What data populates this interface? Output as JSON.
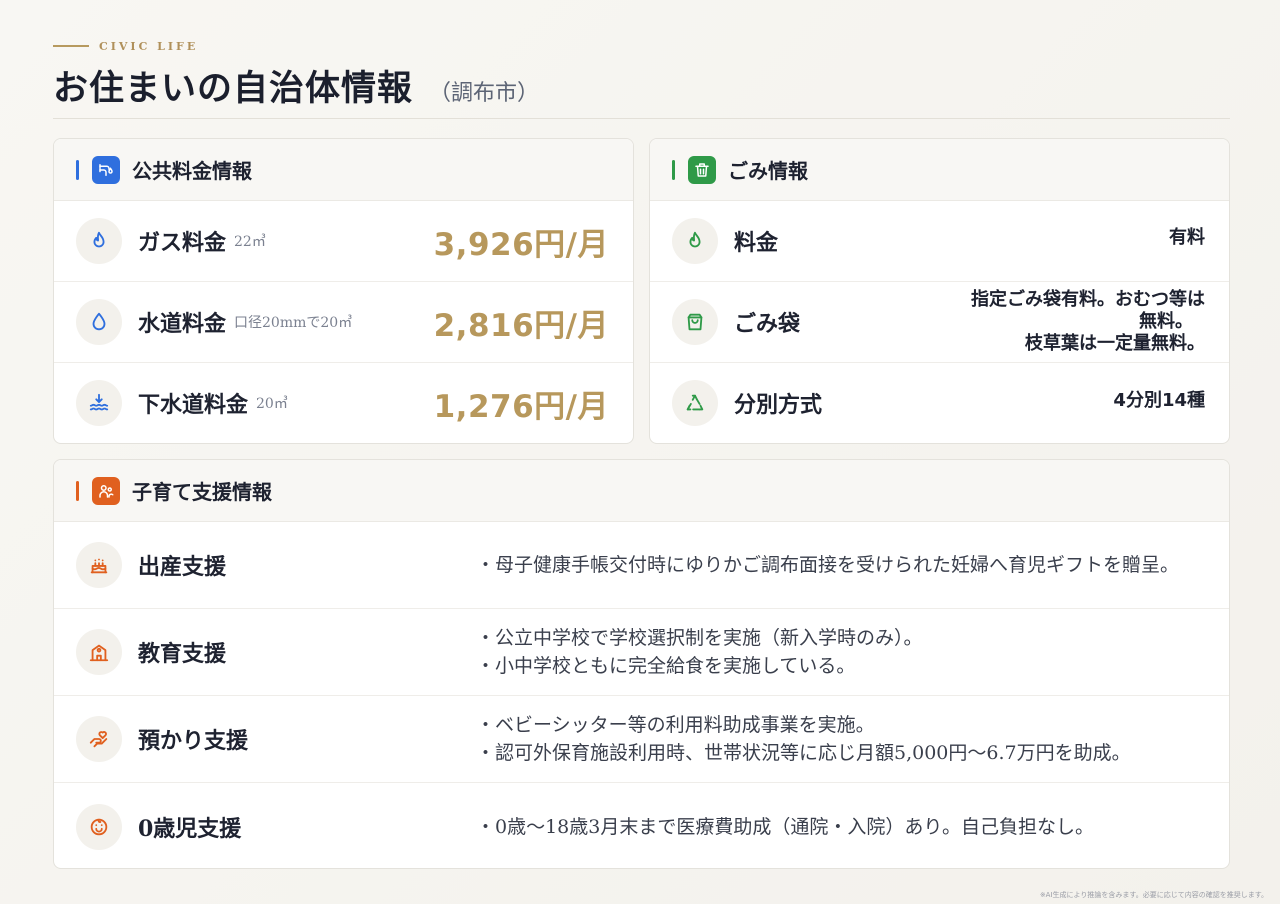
{
  "header": {
    "eyebrow": "CIVIC LIFE",
    "title": "お住まいの自治体情報",
    "subtitle": "（調布市）"
  },
  "utilities": {
    "title": "公共料金情報",
    "accent": "#2f6fde",
    "rows": [
      {
        "label": "ガス料金",
        "note": "22㎥",
        "price": "3,926円/月",
        "icon": "flame-icon"
      },
      {
        "label": "水道料金",
        "note": "口径20mmで20㎥",
        "price": "2,816円/月",
        "icon": "water-drop-icon"
      },
      {
        "label": "下水道料金",
        "note": "20㎥",
        "price": "1,276円/月",
        "icon": "sewer-waves-icon"
      }
    ]
  },
  "garbage": {
    "title": "ごみ情報",
    "accent": "#2f9a48",
    "rows": [
      {
        "label": "料金",
        "value": "有料",
        "icon": "flame-icon"
      },
      {
        "label": "ごみ袋",
        "value_lines": [
          "指定ごみ袋有料。おむつ等は",
          "無料。",
          "枝草葉は一定量無料。"
        ],
        "icon": "shopping-bag-icon"
      },
      {
        "label": "分別方式",
        "value": "4分別14種",
        "icon": "recycle-icon"
      }
    ]
  },
  "childcare": {
    "title": "子育て支援情報",
    "accent": "#e0601f",
    "rows": [
      {
        "label": "出産支援",
        "icon": "birthday-cake-icon",
        "lines": [
          "・母子健康手帳交付時にゆりかご調布面接を受けられた妊婦へ育児ギフトを贈呈。"
        ]
      },
      {
        "label": "教育支援",
        "icon": "school-icon",
        "lines": [
          "・公立中学校で学校選択制を実施（新入学時のみ）。",
          "・小中学校ともに完全給食を実施している。"
        ]
      },
      {
        "label": "預かり支援",
        "icon": "hand-holding-heart-icon",
        "lines": [
          "・ベビーシッター等の利用料助成事業を実施。",
          "・認可外保育施設利用時、世帯状況等に応じ月額5,000円〜6.7万円を助成。"
        ]
      },
      {
        "label": "0歳児支援",
        "icon": "baby-face-icon",
        "lines": [
          "・0歳〜18歳3月末まで医療費助成（通院・入院）あり。自己負担なし。"
        ]
      }
    ]
  },
  "footnote": "※AI生成により推論を含みます。必要に応じて内容の確認を推奨します。"
}
